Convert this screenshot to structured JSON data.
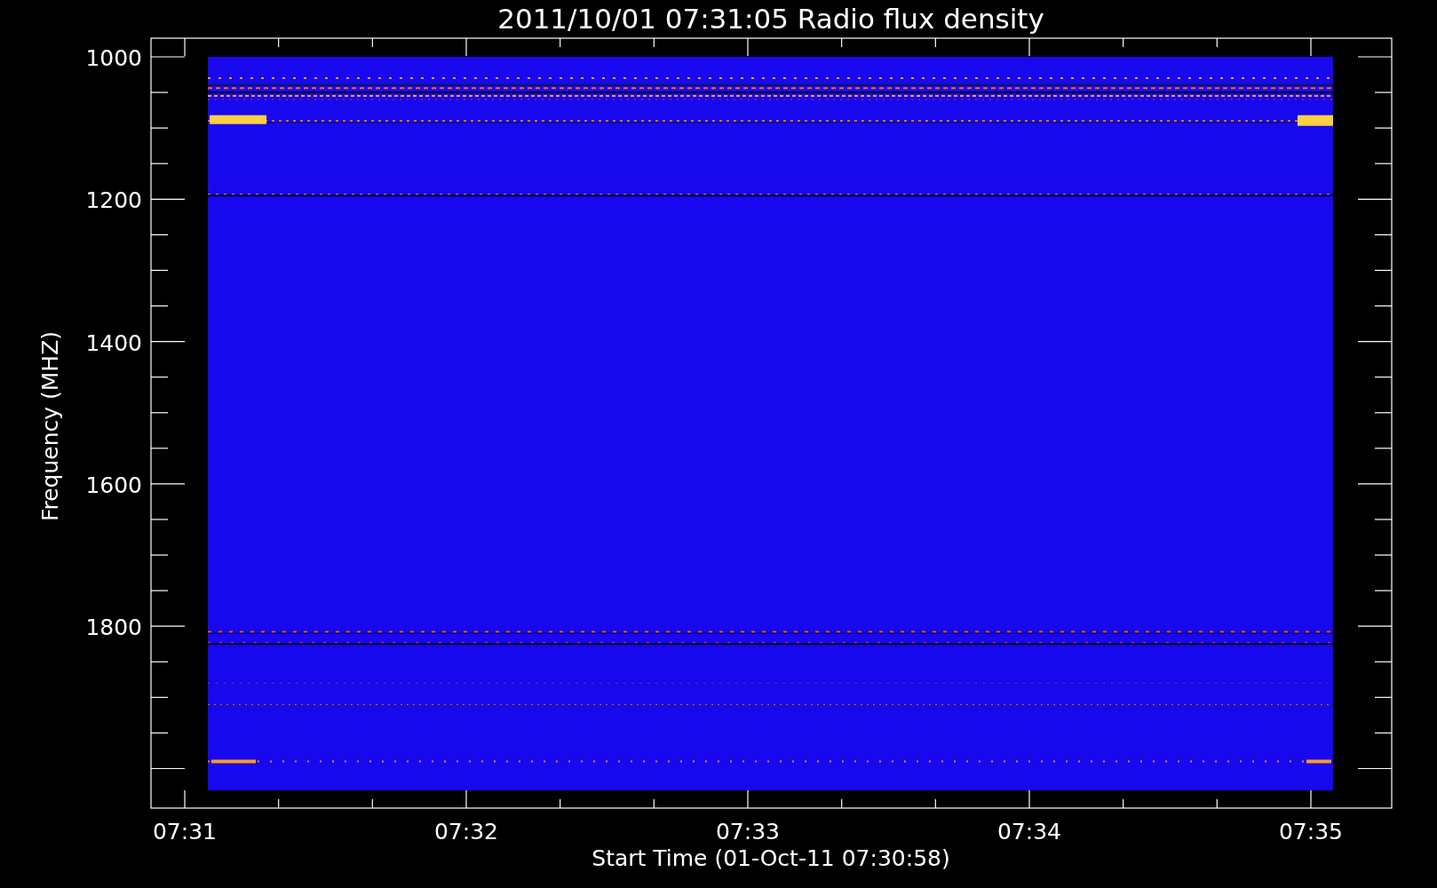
{
  "title": "2011/10/01 07:31:05 Radio flux density",
  "plot": {
    "ylabel": "Frequency (MHZ)",
    "xlabel": "Start Time (01-Oct-11 07:30:58)",
    "yticks": [
      "1000",
      "1200",
      "1400",
      "1600",
      "1800"
    ],
    "xticks": [
      "07:31",
      "07:32",
      "07:33",
      "07:34",
      "07:35"
    ]
  }
}
